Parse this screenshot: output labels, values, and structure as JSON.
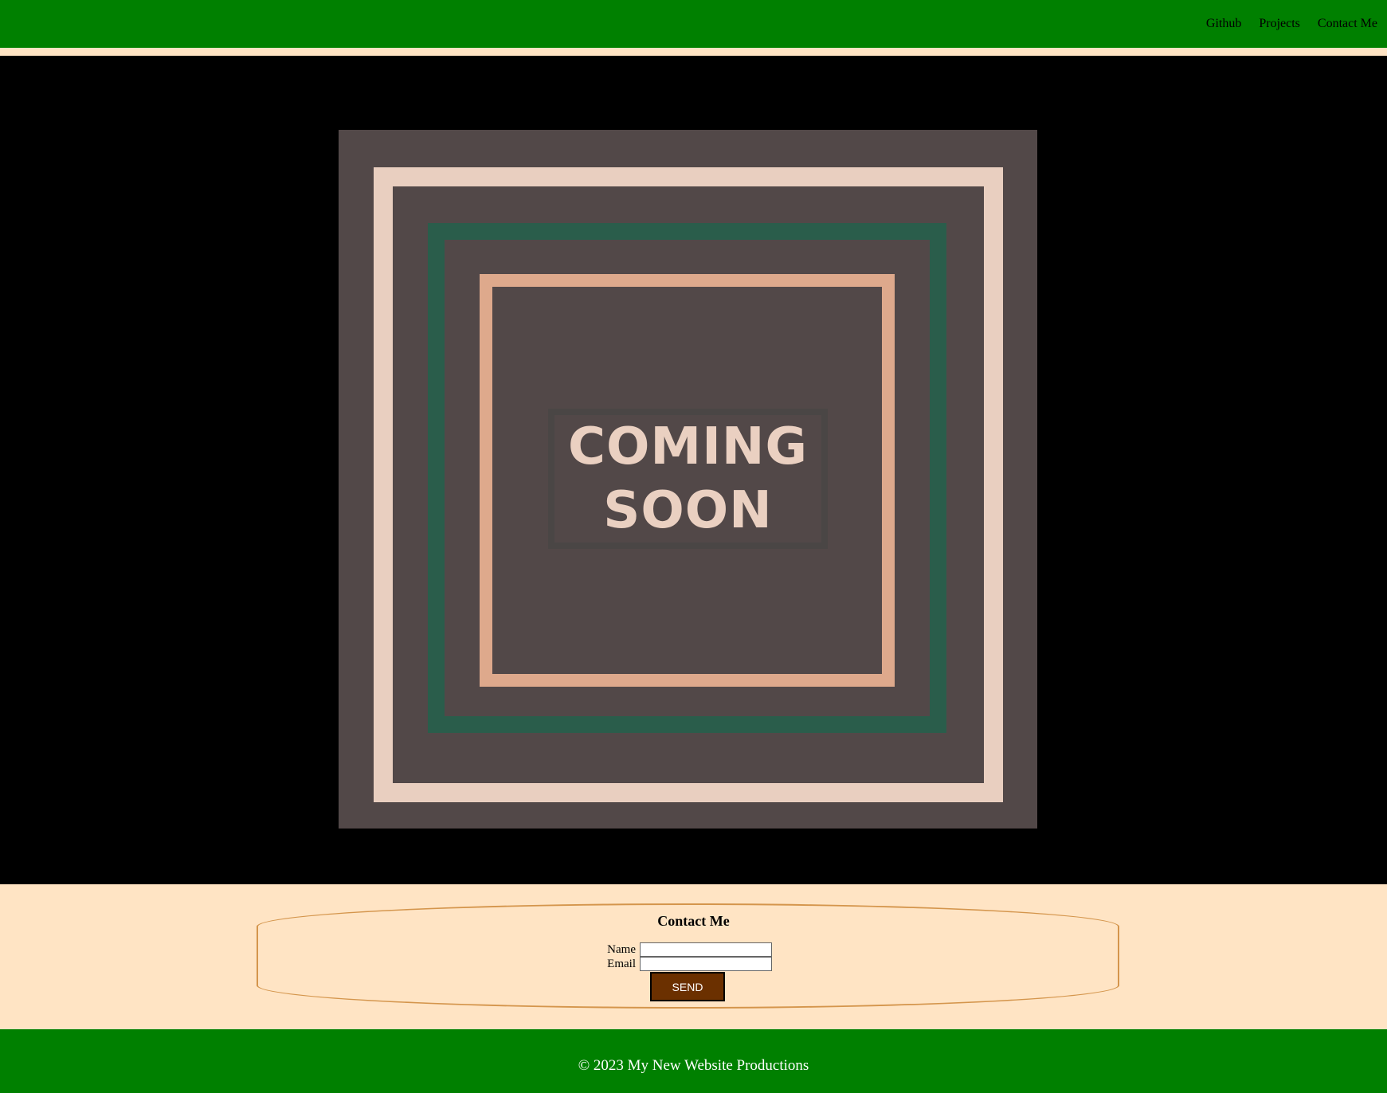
{
  "nav": {
    "items": [
      {
        "label": "Github"
      },
      {
        "label": "Projects"
      },
      {
        "label": "Contact Me"
      }
    ]
  },
  "hero": {
    "poster": {
      "line1": "COMING",
      "line2": "SOON"
    }
  },
  "contact": {
    "title": "Contact Me",
    "fields": {
      "name_label": "Name",
      "name_value": "",
      "email_label": "Email",
      "email_value": ""
    },
    "send_label": "SEND"
  },
  "footer": {
    "text": "© 2023 My New Website Productions"
  },
  "colors": {
    "header_bg": "#008000",
    "page_bg": "#ffe4c4",
    "hero_bg": "#000000",
    "poster_bg": "#524848",
    "frame_outer": "#e9cfc0",
    "frame_middle": "#2a5d4b",
    "frame_inner": "#dea98c",
    "send_button_bg": "#6b3000",
    "oval_border": "#d4954c"
  }
}
